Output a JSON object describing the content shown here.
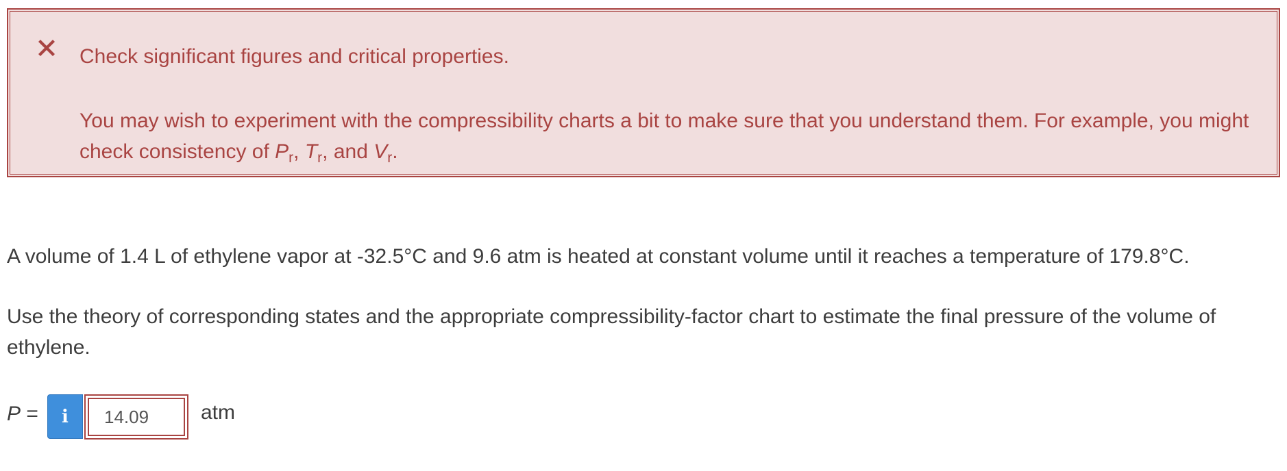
{
  "feedback": {
    "title": "Check significant figures and critical properties.",
    "body_prefix": "You may wish to experiment with the compressibility charts a bit to make sure that you understand them. For example, you might check consistency of ",
    "pr_symbol": "P",
    "pr_sub": "r",
    "sep1": ", ",
    "tr_symbol": "T",
    "tr_sub": "r",
    "sep2": ", and ",
    "vr_symbol": "V",
    "vr_sub": "r",
    "body_suffix": ".",
    "icon": "close-x-icon",
    "color": "#a94442",
    "background": "#f1dede"
  },
  "problem": {
    "paragraph1": "A volume of 1.4 L of ethylene vapor at -32.5°C and 9.6 atm is heated at constant volume until it reaches a temperature of 179.8°C.",
    "paragraph2": "Use the theory of corresponding states and the appropriate compressibility-factor chart to estimate the final pressure of the volume of ethylene."
  },
  "answer": {
    "variable": "P",
    "equals": " =",
    "info_icon": "info-icon",
    "info_glyph": "i",
    "value": "14.09",
    "unit": "atm"
  }
}
